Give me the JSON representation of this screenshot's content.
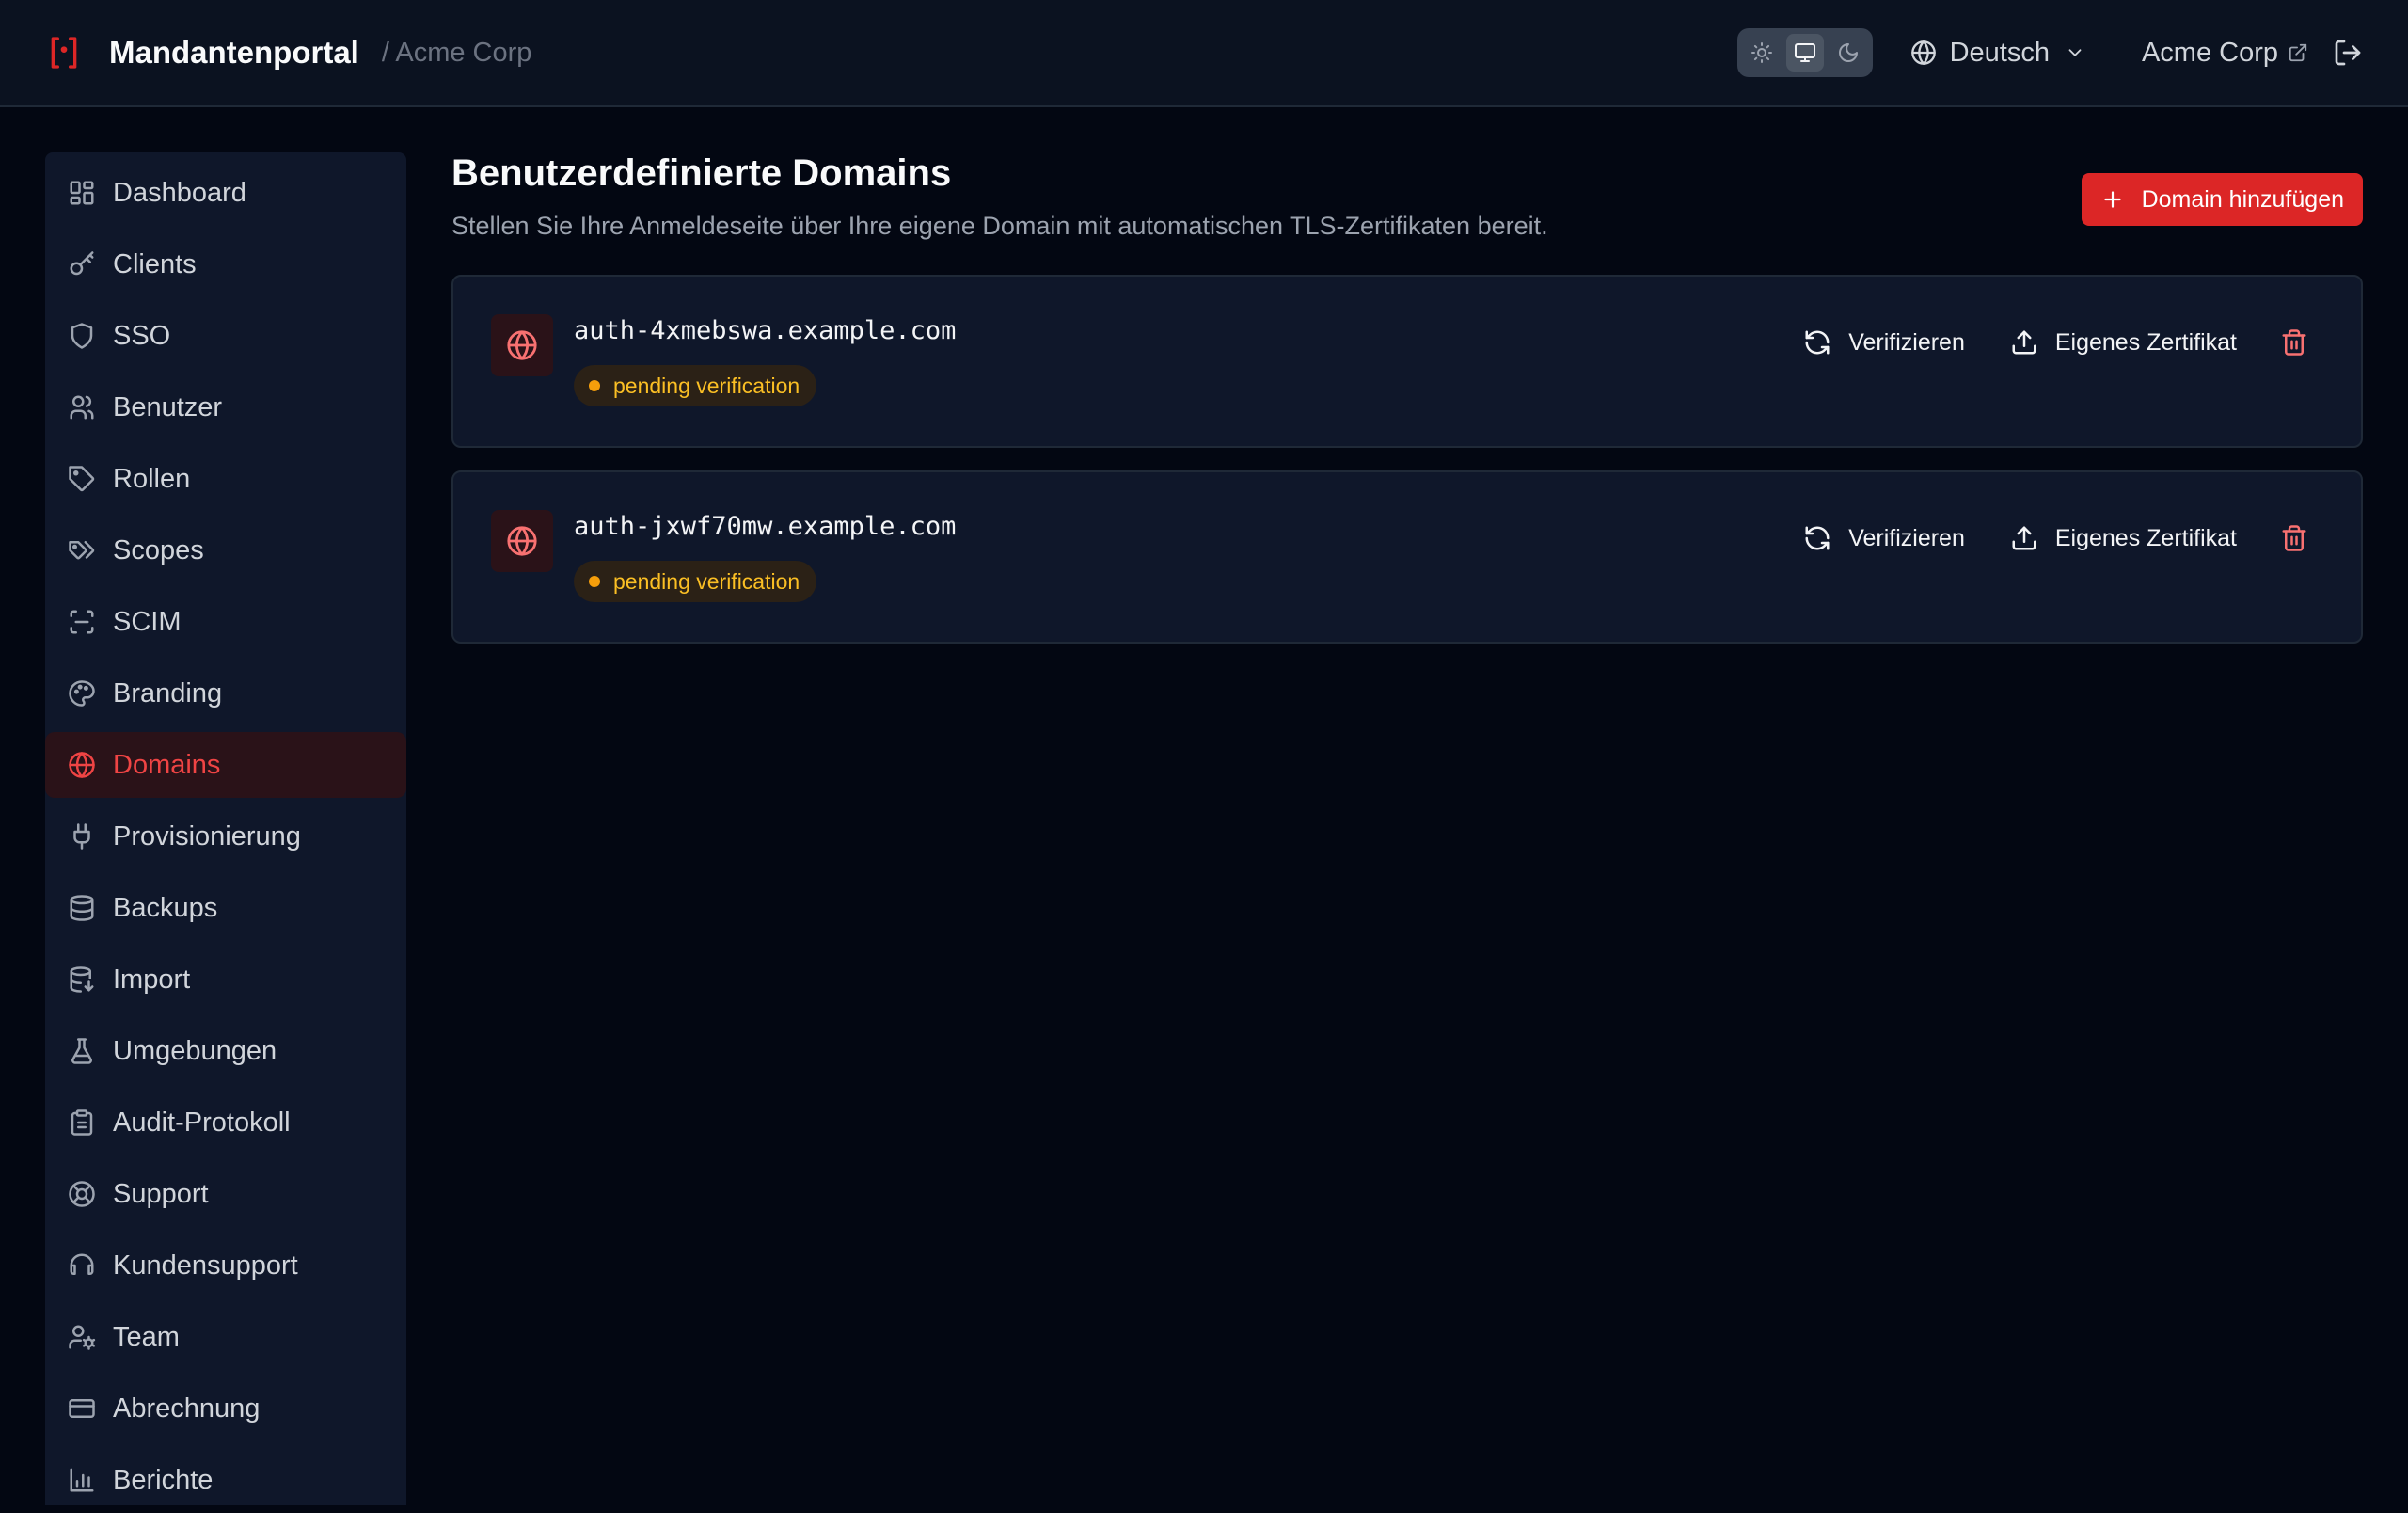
{
  "header": {
    "app_title": "Mandantenportal",
    "tenant_crumb": "/ Acme Corp",
    "language": "Deutsch",
    "tenant_link": "Acme Corp",
    "theme_options": [
      "sun-icon",
      "monitor-icon",
      "moon-icon"
    ],
    "active_theme": "monitor-icon"
  },
  "sidebar": {
    "items": [
      {
        "label": "Dashboard",
        "icon": "dashboard-icon"
      },
      {
        "label": "Clients",
        "icon": "key-icon"
      },
      {
        "label": "SSO",
        "icon": "shield-icon"
      },
      {
        "label": "Benutzer",
        "icon": "users-icon"
      },
      {
        "label": "Rollen",
        "icon": "tag-icon"
      },
      {
        "label": "Scopes",
        "icon": "tags-icon"
      },
      {
        "label": "SCIM",
        "icon": "scan-icon"
      },
      {
        "label": "Branding",
        "icon": "palette-icon"
      },
      {
        "label": "Domains",
        "icon": "globe-icon",
        "active": true
      },
      {
        "label": "Provisionierung",
        "icon": "plug-icon"
      },
      {
        "label": "Backups",
        "icon": "database-icon"
      },
      {
        "label": "Import",
        "icon": "database-import-icon"
      },
      {
        "label": "Umgebungen",
        "icon": "flask-icon"
      },
      {
        "label": "Audit-Protokoll",
        "icon": "clipboard-icon"
      },
      {
        "label": "Support",
        "icon": "lifebuoy-icon"
      },
      {
        "label": "Kundensupport",
        "icon": "headset-icon"
      },
      {
        "label": "Team",
        "icon": "user-cog-icon"
      },
      {
        "label": "Abrechnung",
        "icon": "credit-card-icon"
      },
      {
        "label": "Berichte",
        "icon": "bar-chart-icon"
      }
    ]
  },
  "main": {
    "title": "Benutzerdefinierte Domains",
    "subtitle": "Stellen Sie Ihre Anmeldeseite über Ihre eigene Domain mit automatischen TLS-Zertifikaten bereit.",
    "add_button": "Domain hinzufügen",
    "domains": [
      {
        "name": "auth-4xmebswa.example.com",
        "status": "pending verification",
        "verify_label": "Verifizieren",
        "cert_label": "Eigenes Zertifikat"
      },
      {
        "name": "auth-jxwf70mw.example.com",
        "status": "pending verification",
        "verify_label": "Verifizieren",
        "cert_label": "Eigenes Zertifikat"
      }
    ]
  },
  "colors": {
    "accent": "#dc2626",
    "background": "#030712",
    "panel": "#0f172a",
    "pending": "#fbbf24"
  }
}
